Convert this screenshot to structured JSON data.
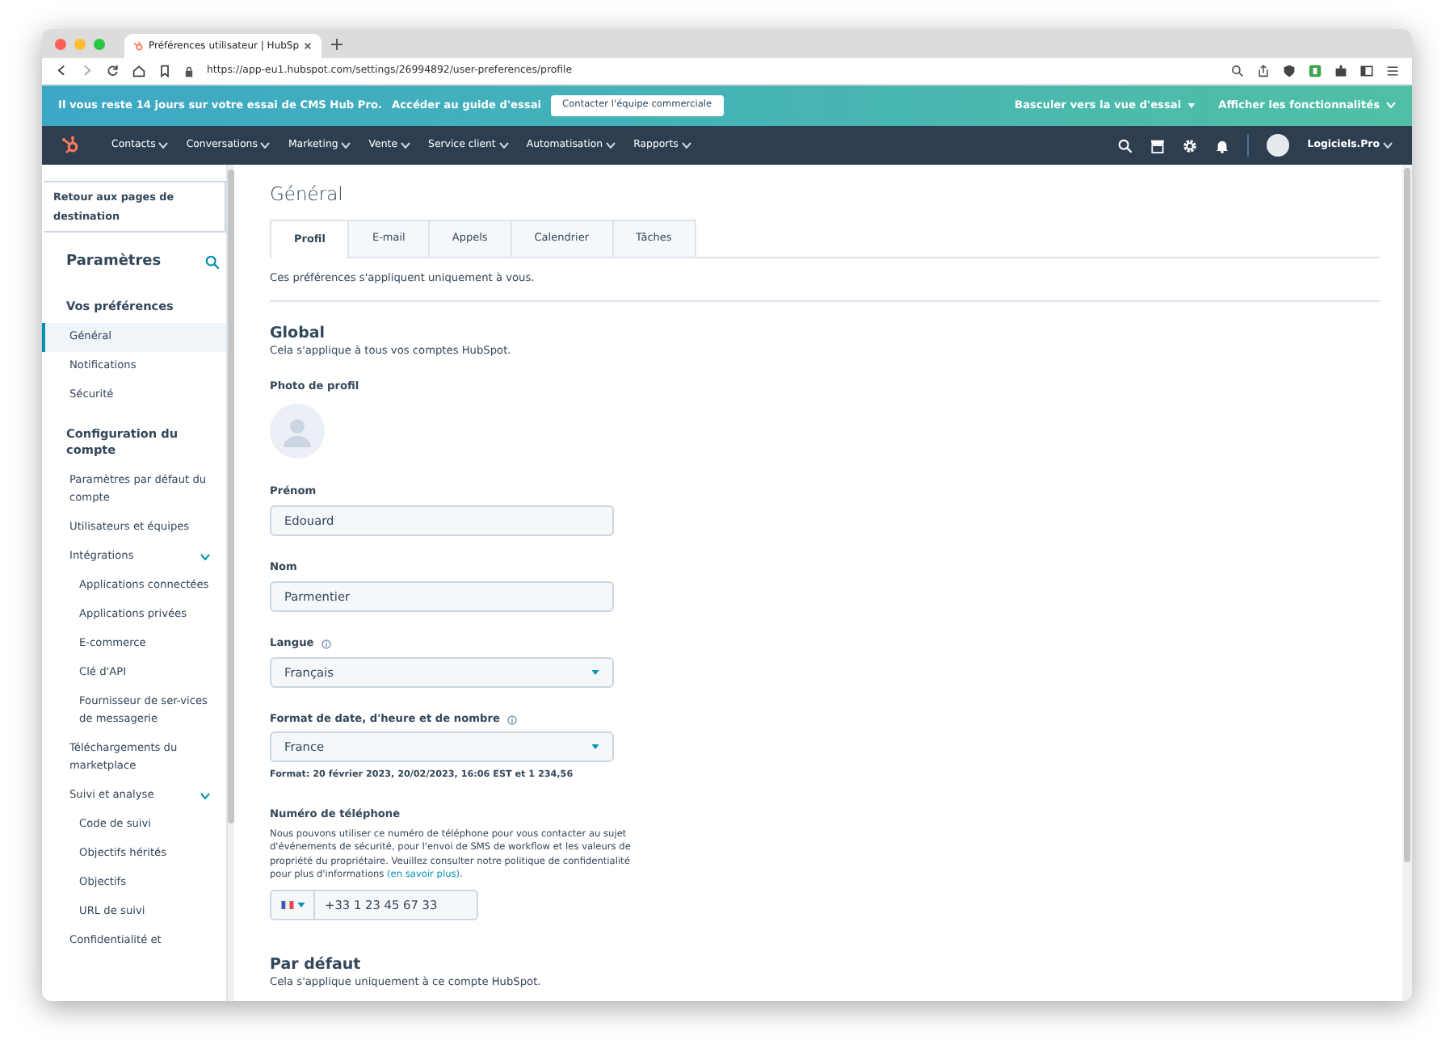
{
  "browser": {
    "tab_title": "Préférences utilisateur | HubSp",
    "url": "https://app-eu1.hubspot.com/settings/26994892/user-preferences/profile"
  },
  "trial_banner": {
    "message": "Il vous reste 14 jours sur votre essai de CMS Hub Pro.",
    "guide_link": "Accéder au guide d'essai",
    "contact_button": "Contacter l'équipe commerciale",
    "switch_view": "Basculer vers la vue d'essai",
    "show_features": "Afficher les fonctionnalités"
  },
  "nav": {
    "items": [
      "Contacts",
      "Conversations",
      "Marketing",
      "Vente",
      "Service client",
      "Automatisation",
      "Rapports"
    ],
    "account": "Logiciels.Pro"
  },
  "sidebar": {
    "back_link": "Retour aux pages de destination",
    "title": "Paramètres",
    "sections": [
      {
        "heading": "Vos préférences",
        "items": [
          {
            "label": "Général",
            "selected": true
          },
          {
            "label": "Notifications",
            "selected": false
          },
          {
            "label": "Sécurité",
            "selected": false
          }
        ]
      },
      {
        "heading": "Configuration du compte",
        "items": [
          {
            "label": "Paramètres par défaut du compte",
            "selected": false
          },
          {
            "label": "Utilisateurs et équipes",
            "selected": false
          },
          {
            "label": "Intégrations",
            "selected": false,
            "expanded": true,
            "children": [
              {
                "label": "Applications connectées",
                "selected": false
              },
              {
                "label": "Applications privées",
                "selected": false
              },
              {
                "label": "E-commerce",
                "selected": false
              },
              {
                "label": "Clé d'API",
                "selected": false
              },
              {
                "label": "Fournisseur de ser-vices de messagerie",
                "selected": false
              }
            ]
          },
          {
            "label": "Téléchargements du marketplace",
            "selected": false
          },
          {
            "label": "Suivi et analyse",
            "selected": false,
            "expanded": true,
            "children": [
              {
                "label": "Code de suivi",
                "selected": false
              },
              {
                "label": "Objectifs hérités",
                "selected": false
              },
              {
                "label": "Objectifs",
                "selected": false
              },
              {
                "label": "URL de suivi",
                "selected": false
              }
            ]
          },
          {
            "label": "Confidentialité et",
            "selected": false
          }
        ]
      }
    ]
  },
  "main": {
    "title": "Général",
    "tabs": [
      {
        "label": "Profil",
        "selected": true
      },
      {
        "label": "E-mail",
        "selected": false
      },
      {
        "label": "Appels",
        "selected": false
      },
      {
        "label": "Calendrier",
        "selected": false
      },
      {
        "label": "Tâches",
        "selected": false
      }
    ],
    "note": "Ces préférences s'appliquent uniquement à vous.",
    "global": {
      "heading": "Global",
      "subtitle": "Cela s'applique à tous vos comptes HubSpot.",
      "photo_label": "Photo de profil",
      "fields": [
        {
          "kind": "text",
          "label": "Prénom",
          "value": "Edouard"
        },
        {
          "kind": "text",
          "label": "Nom",
          "value": "Parmentier"
        },
        {
          "kind": "select",
          "label": "Langue",
          "value": "Français",
          "info": true
        },
        {
          "kind": "select",
          "label": "Format de date, d'heure et de nombre",
          "value": "France",
          "info": true,
          "hint": "Format: 20 février 2023, 20/02/2023, 16:06 EST et 1 234,56"
        },
        {
          "kind": "phone",
          "label": "Numéro de téléphone",
          "help": "Nous pouvons utiliser ce numéro de téléphone pour vous contacter au sujet d'événements de sécurité, pour l'envoi de SMS de workflow et les valeurs de propriété du propriétaire. Veuillez consulter notre politique de confidentialité pour plus d'informations ",
          "help_link": "(en savoir plus)",
          "help_end": ".",
          "value": "+33 1 23 45 67 33"
        }
      ]
    },
    "default_section": {
      "heading": "Par défaut",
      "subtitle": "Cela s'applique uniquement à ce compte HubSpot."
    }
  }
}
